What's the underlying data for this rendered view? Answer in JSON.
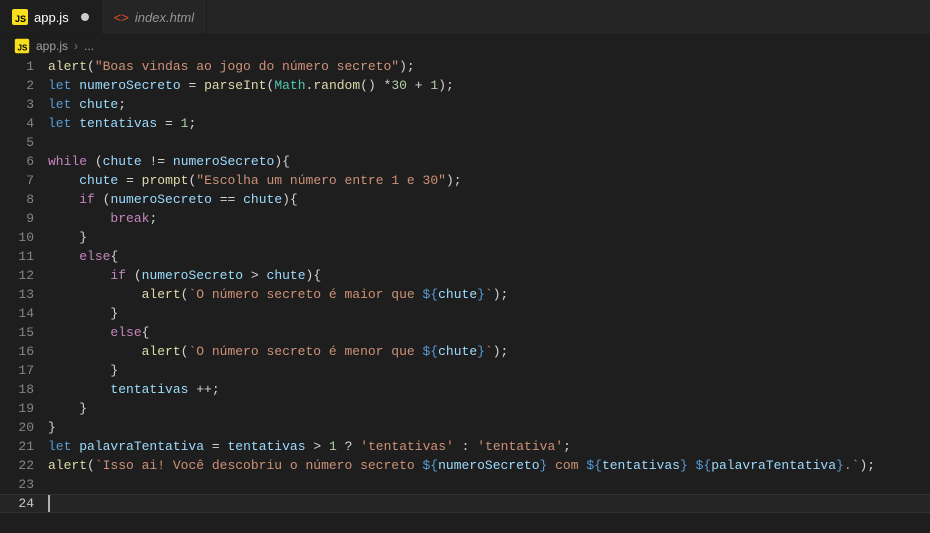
{
  "tabs": [
    {
      "icon": "js",
      "label": "app.js",
      "active": true,
      "dirty": true
    },
    {
      "icon": "html",
      "label": "index.html",
      "active": false,
      "dirty": false
    }
  ],
  "breadcrumb": {
    "icon": "js",
    "file": "app.js",
    "trail": "..."
  },
  "gutter_start": 1,
  "gutter_end": 24,
  "highlight_line": 24,
  "code": {
    "l1": {
      "a": "alert",
      "s": "\"Boas vindas ao jogo do número secreto\""
    },
    "l2": {
      "kw": "let",
      "v": "numeroSecreto",
      "fn": "parseInt",
      "obj": "Math",
      "m": "random",
      "n1": "30",
      "n2": "1"
    },
    "l3": {
      "kw": "let",
      "v": "chute"
    },
    "l4": {
      "kw": "let",
      "v": "tentativas",
      "n": "1"
    },
    "l6": {
      "kw": "while",
      "v1": "chute",
      "v2": "numeroSecreto"
    },
    "l7": {
      "v": "chute",
      "fn": "prompt",
      "s": "\"Escolha um número entre 1 e 30\""
    },
    "l8": {
      "kw": "if",
      "v1": "numeroSecreto",
      "v2": "chute"
    },
    "l9": {
      "kw": "break"
    },
    "l11": {
      "kw": "else"
    },
    "l12": {
      "kw": "if",
      "v1": "numeroSecreto",
      "v2": "chute"
    },
    "l13": {
      "fn": "alert",
      "s1": "`O número secreto é maior que ",
      "v": "chute",
      "s2": "`"
    },
    "l15": {
      "kw": "else"
    },
    "l16": {
      "fn": "alert",
      "s1": "`O número secreto é menor que ",
      "v": "chute",
      "s2": "`"
    },
    "l18": {
      "v": "tentativas"
    },
    "l21": {
      "kw": "let",
      "v": "palavraTentativa",
      "v2": "tentativas",
      "n": "1",
      "s1": "'tentativas'",
      "s2": "'tentativa'"
    },
    "l22": {
      "fn": "alert",
      "s1": "`Isso ai! Você descobriu o número secreto ",
      "v1": "numeroSecreto",
      "s2": " com ",
      "v2": "tentativas",
      "s3": " ",
      "v3": "palavraTentativa",
      "s4": ".`"
    }
  }
}
